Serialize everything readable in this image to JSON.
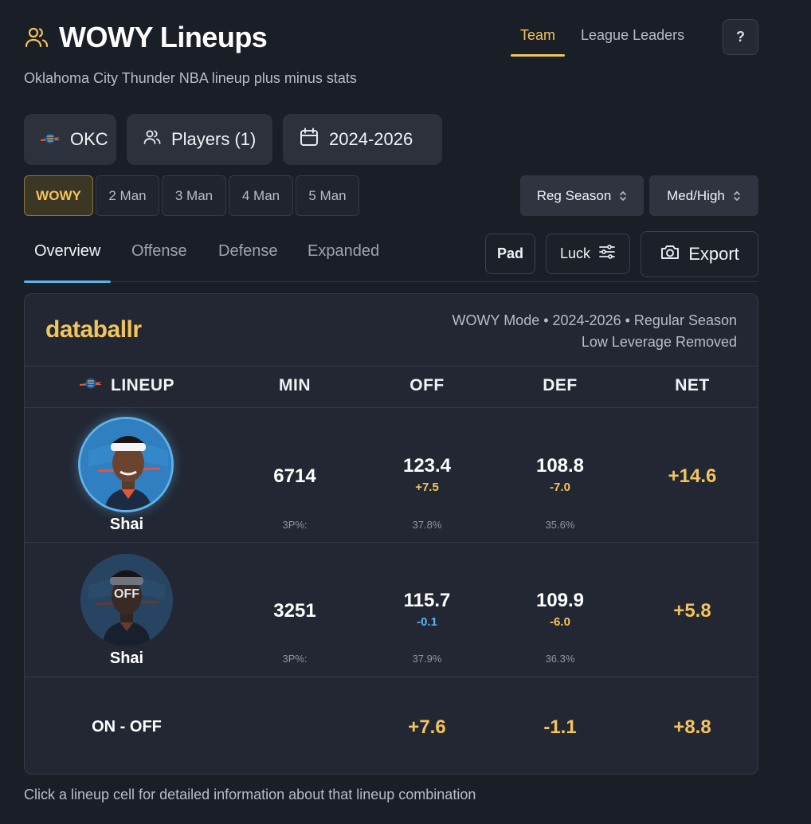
{
  "header": {
    "title": "WOWY Lineups",
    "subtitle": "Oklahoma City Thunder NBA lineup plus minus stats",
    "title_icon": "users-icon"
  },
  "top_tabs": [
    {
      "label": "Team",
      "active": true
    },
    {
      "label": "League Leaders",
      "active": false
    }
  ],
  "help_label": "?",
  "filters": {
    "team": "OKC",
    "players": "Players (1)",
    "seasons": "2024-2026"
  },
  "lineup_sizes": [
    {
      "label": "WOWY",
      "active": true
    },
    {
      "label": "2 Man",
      "active": false
    },
    {
      "label": "3 Man",
      "active": false
    },
    {
      "label": "4 Man",
      "active": false
    },
    {
      "label": "5 Man",
      "active": false
    }
  ],
  "selects": {
    "season_type": "Reg Season",
    "leverage": "Med/High"
  },
  "view_tabs": [
    {
      "label": "Overview",
      "active": true
    },
    {
      "label": "Offense",
      "active": false
    },
    {
      "label": "Defense",
      "active": false
    },
    {
      "label": "Expanded",
      "active": false
    }
  ],
  "actions": {
    "pad": "Pad",
    "luck": "Luck",
    "export": "Export"
  },
  "card": {
    "brand": "databallr",
    "mode_line1": "WOWY Mode • 2024-2026 • Regular Season",
    "mode_line2": "Low Leverage Removed",
    "columns": [
      "LINEUP",
      "MIN",
      "OFF",
      "DEF",
      "NET"
    ],
    "rows": [
      {
        "player": "Shai",
        "status": "ON",
        "min": "6714",
        "off": "123.4",
        "off_delta": "+7.5",
        "def": "108.8",
        "def_delta": "-7.0",
        "net": "+14.6",
        "threep_label": "3P%:",
        "threep_off": "37.8%",
        "threep_def": "35.6%"
      },
      {
        "player": "Shai",
        "status": "OFF",
        "min": "3251",
        "off": "115.7",
        "off_delta": "-0.1",
        "def": "109.9",
        "def_delta": "-6.0",
        "net": "+5.8",
        "threep_label": "3P%:",
        "threep_off": "37.9%",
        "threep_def": "36.3%"
      }
    ],
    "on_off": {
      "label": "ON - OFF",
      "off": "+7.6",
      "def": "-1.1",
      "net": "+8.8"
    }
  },
  "footer_note": "Click a lineup cell for detailed information about that lineup combination",
  "colors": {
    "background": "#1a1e26",
    "accent_gold": "#f2c55c",
    "accent_blue": "#5db2ea",
    "card": "#222733"
  }
}
